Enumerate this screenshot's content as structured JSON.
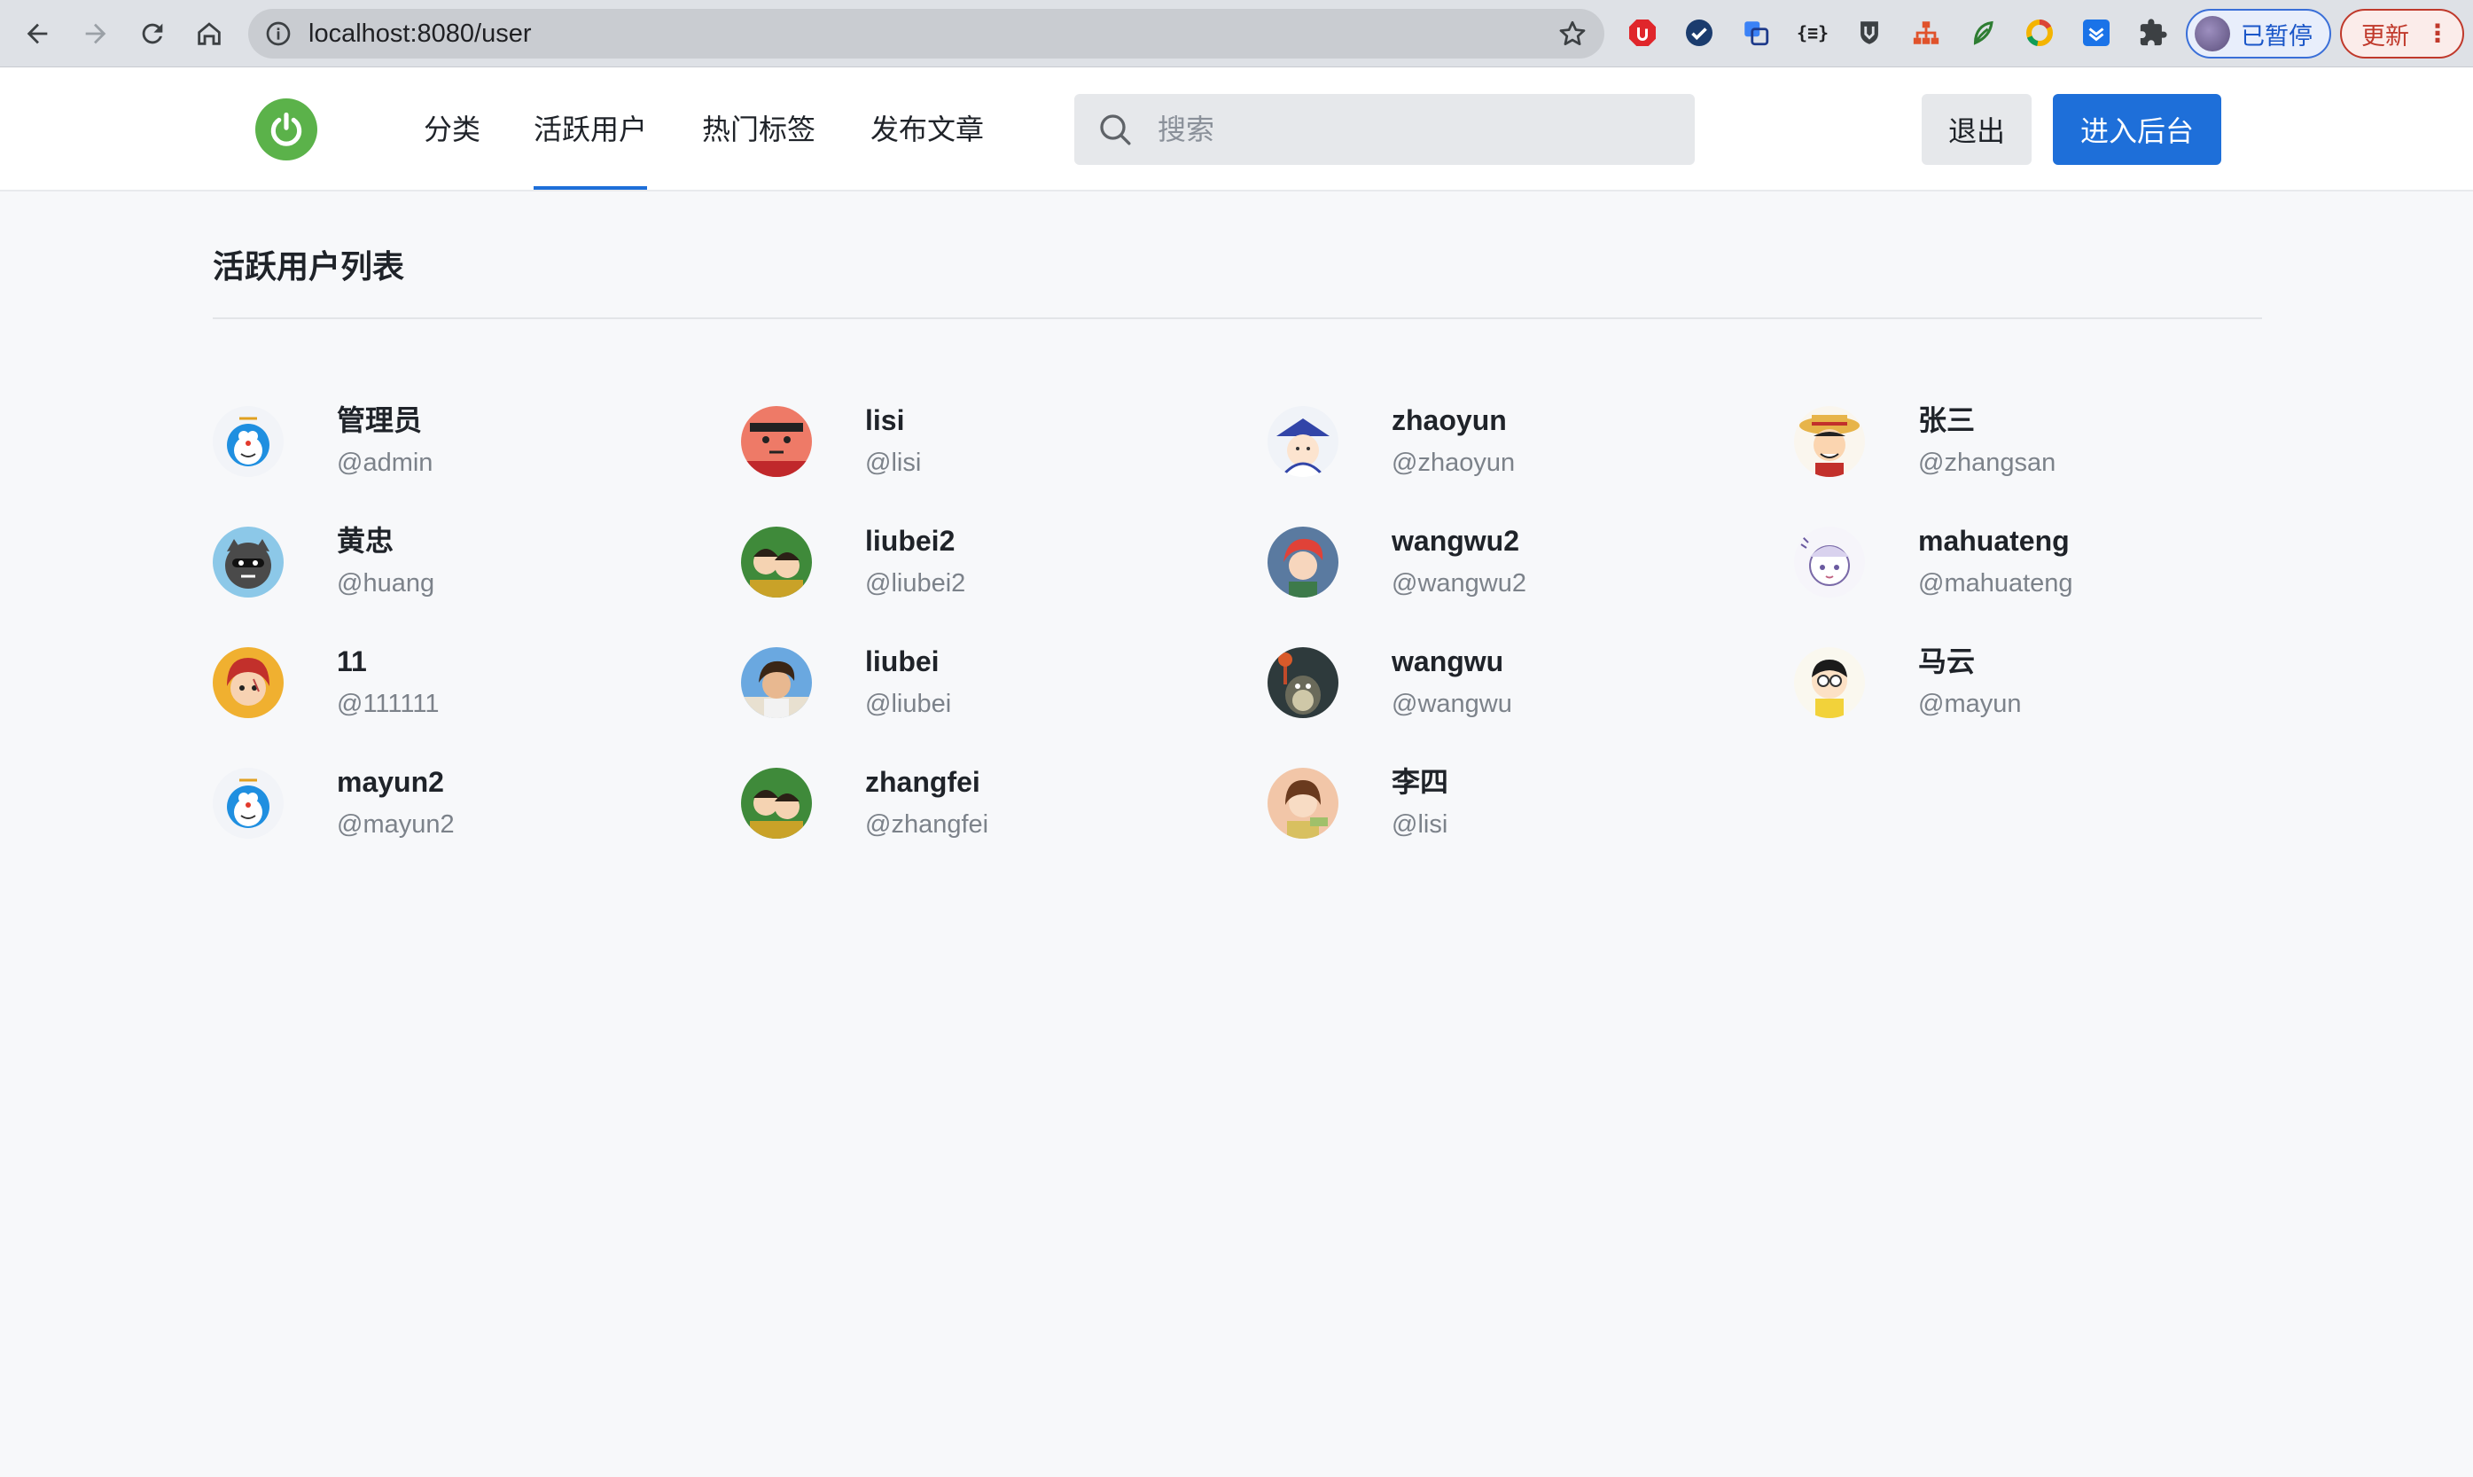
{
  "browser": {
    "url": "localhost:8080/user",
    "profile_label": "已暂停",
    "update_label": "更新"
  },
  "header": {
    "menu": [
      "分类",
      "活跃用户",
      "热门标签",
      "发布文章"
    ],
    "active_menu": "活跃用户",
    "search_placeholder": "搜索",
    "logout_label": "退出",
    "admin_label": "进入后台",
    "accent_color": "#1e6fd9",
    "logo_color": "#5bb24a"
  },
  "main": {
    "title": "活跃用户列表",
    "users": [
      {
        "name": "管理员",
        "handle": "@admin",
        "avatar": "doraemon-avatar"
      },
      {
        "name": "lisi",
        "handle": "@lisi",
        "avatar": "crayon-shin-avatar"
      },
      {
        "name": "zhaoyun",
        "handle": "@zhaoyun",
        "avatar": "kid-avatar"
      },
      {
        "name": "张三",
        "handle": "@zhangsan",
        "avatar": "luffy-avatar"
      },
      {
        "name": "黄忠",
        "handle": "@huang",
        "avatar": "cat-avatar"
      },
      {
        "name": "liubei2",
        "handle": "@liubei2",
        "avatar": "anime-couple-avatar"
      },
      {
        "name": "wangwu2",
        "handle": "@wangwu2",
        "avatar": "red-hair-avatar"
      },
      {
        "name": "mahuateng",
        "handle": "@mahuateng",
        "avatar": "chibi-avatar"
      },
      {
        "name": "11",
        "handle": "@111111",
        "avatar": "shanks-avatar"
      },
      {
        "name": "liubei",
        "handle": "@liubei",
        "avatar": "boy-sky-avatar"
      },
      {
        "name": "wangwu",
        "handle": "@wangwu",
        "avatar": "totoro-avatar"
      },
      {
        "name": "马云",
        "handle": "@mayun",
        "avatar": "nobita-avatar"
      },
      {
        "name": "mayun2",
        "handle": "@mayun2",
        "avatar": "doraemon-avatar"
      },
      {
        "name": "zhangfei",
        "handle": "@zhangfei",
        "avatar": "anime-couple-avatar"
      },
      {
        "name": "李四",
        "handle": "@lisi",
        "avatar": "chihiro-avatar"
      }
    ]
  }
}
